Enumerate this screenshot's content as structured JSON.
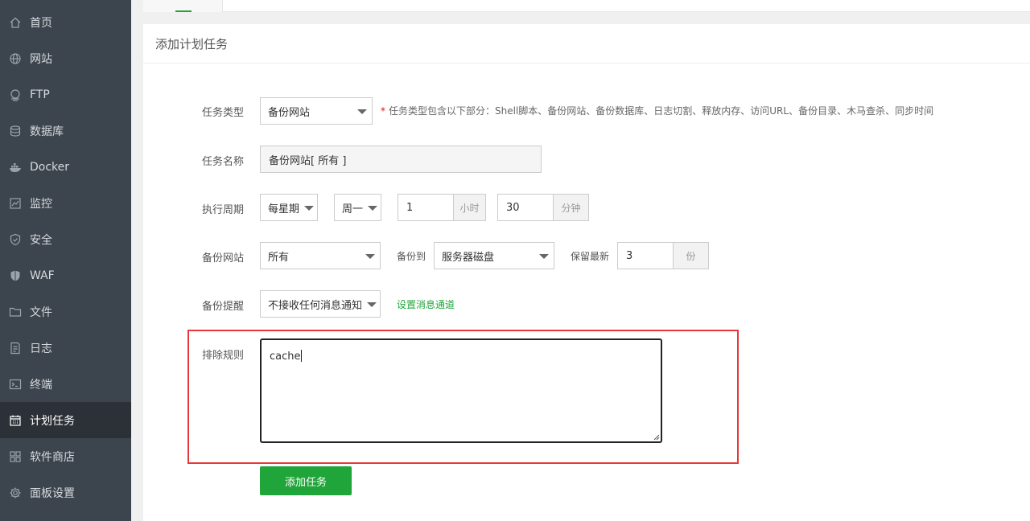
{
  "sidebar": {
    "items": [
      {
        "label": "首页",
        "icon": "home-icon"
      },
      {
        "label": "网站",
        "icon": "globe-icon"
      },
      {
        "label": "FTP",
        "icon": "ftp-icon"
      },
      {
        "label": "数据库",
        "icon": "database-icon"
      },
      {
        "label": "Docker",
        "icon": "docker-icon"
      },
      {
        "label": "监控",
        "icon": "monitor-icon"
      },
      {
        "label": "安全",
        "icon": "shield-icon"
      },
      {
        "label": "WAF",
        "icon": "waf-shield-icon"
      },
      {
        "label": "文件",
        "icon": "folder-icon"
      },
      {
        "label": "日志",
        "icon": "log-icon"
      },
      {
        "label": "终端",
        "icon": "terminal-icon"
      },
      {
        "label": "计划任务",
        "icon": "calendar-icon",
        "active": true
      },
      {
        "label": "软件商店",
        "icon": "apps-grid-icon"
      },
      {
        "label": "面板设置",
        "icon": "gear-icon"
      }
    ]
  },
  "panel": {
    "title": "添加计划任务"
  },
  "form": {
    "task_type": {
      "label": "任务类型",
      "value": "备份网站",
      "hint": "任务类型包含以下部分：Shell脚本、备份网站、备份数据库、日志切割、释放内存、访问URL、备份目录、木马查杀、同步时间",
      "hint_star": "*"
    },
    "task_name": {
      "label": "任务名称",
      "value": "备份网站[ 所有 ]"
    },
    "period": {
      "label": "执行周期",
      "cycle": "每星期",
      "weekday": "周一",
      "hour": "1",
      "hour_unit": "小时",
      "minute": "30",
      "minute_unit": "分钟"
    },
    "backup_site": {
      "label": "备份网站",
      "value": "所有",
      "dest_label": "备份到",
      "dest_value": "服务器磁盘",
      "keep_label": "保留最新",
      "keep_value": "3",
      "keep_unit": "份"
    },
    "notify": {
      "label": "备份提醒",
      "value": "不接收任何消息通知",
      "link": "设置消息通道"
    },
    "exclude": {
      "label": "排除规则",
      "value": "cache"
    },
    "submit": "添加任务"
  },
  "colors": {
    "accent": "#20a53a",
    "sidebar_bg": "#3c444d",
    "highlight": "#e8373a"
  }
}
